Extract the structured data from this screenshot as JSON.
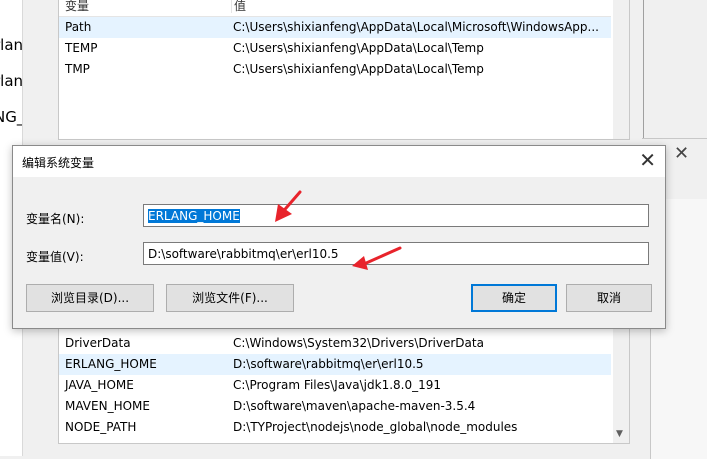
{
  "left_fragments": [
    "rlang",
    "rlang",
    "NG_"
  ],
  "user_vars": {
    "header": {
      "name": "变量",
      "value": "值"
    },
    "rows": [
      {
        "name": "Path",
        "value": "C:\\Users\\shixianfeng\\AppData\\Local\\Microsoft\\WindowsApp...",
        "selected": true
      },
      {
        "name": "TEMP",
        "value": "C:\\Users\\shixianfeng\\AppData\\Local\\Temp"
      },
      {
        "name": "TMP",
        "value": "C:\\Users\\shixianfeng\\AppData\\Local\\Temp"
      }
    ]
  },
  "system_vars": {
    "rows": [
      {
        "name": "DriverData",
        "value": "C:\\Windows\\System32\\Drivers\\DriverData"
      },
      {
        "name": "ERLANG_HOME",
        "value": "D:\\software\\rabbitmq\\er\\erl10.5",
        "selected": true
      },
      {
        "name": "JAVA_HOME",
        "value": "C:\\Program Files\\Java\\jdk1.8.0_191"
      },
      {
        "name": "MAVEN_HOME",
        "value": "D:\\software\\maven\\apache-maven-3.5.4"
      },
      {
        "name": "NODE_PATH",
        "value": "D:\\TYProject\\nodejs\\node_global\\node_modules"
      }
    ]
  },
  "dialog": {
    "title": "编辑系统变量",
    "close_glyph": "✕",
    "name_label": "变量名(N):",
    "name_value": "ERLANG_HOME",
    "value_label": "变量值(V):",
    "value_value": "D:\\software\\rabbitmq\\er\\erl10.5",
    "buttons": {
      "browse_dir": "浏览目录(D)...",
      "browse_file": "浏览文件(F)...",
      "ok": "确定",
      "cancel": "取消"
    }
  },
  "background_close_glyph": "✕",
  "annotation_color": "#e8232b"
}
